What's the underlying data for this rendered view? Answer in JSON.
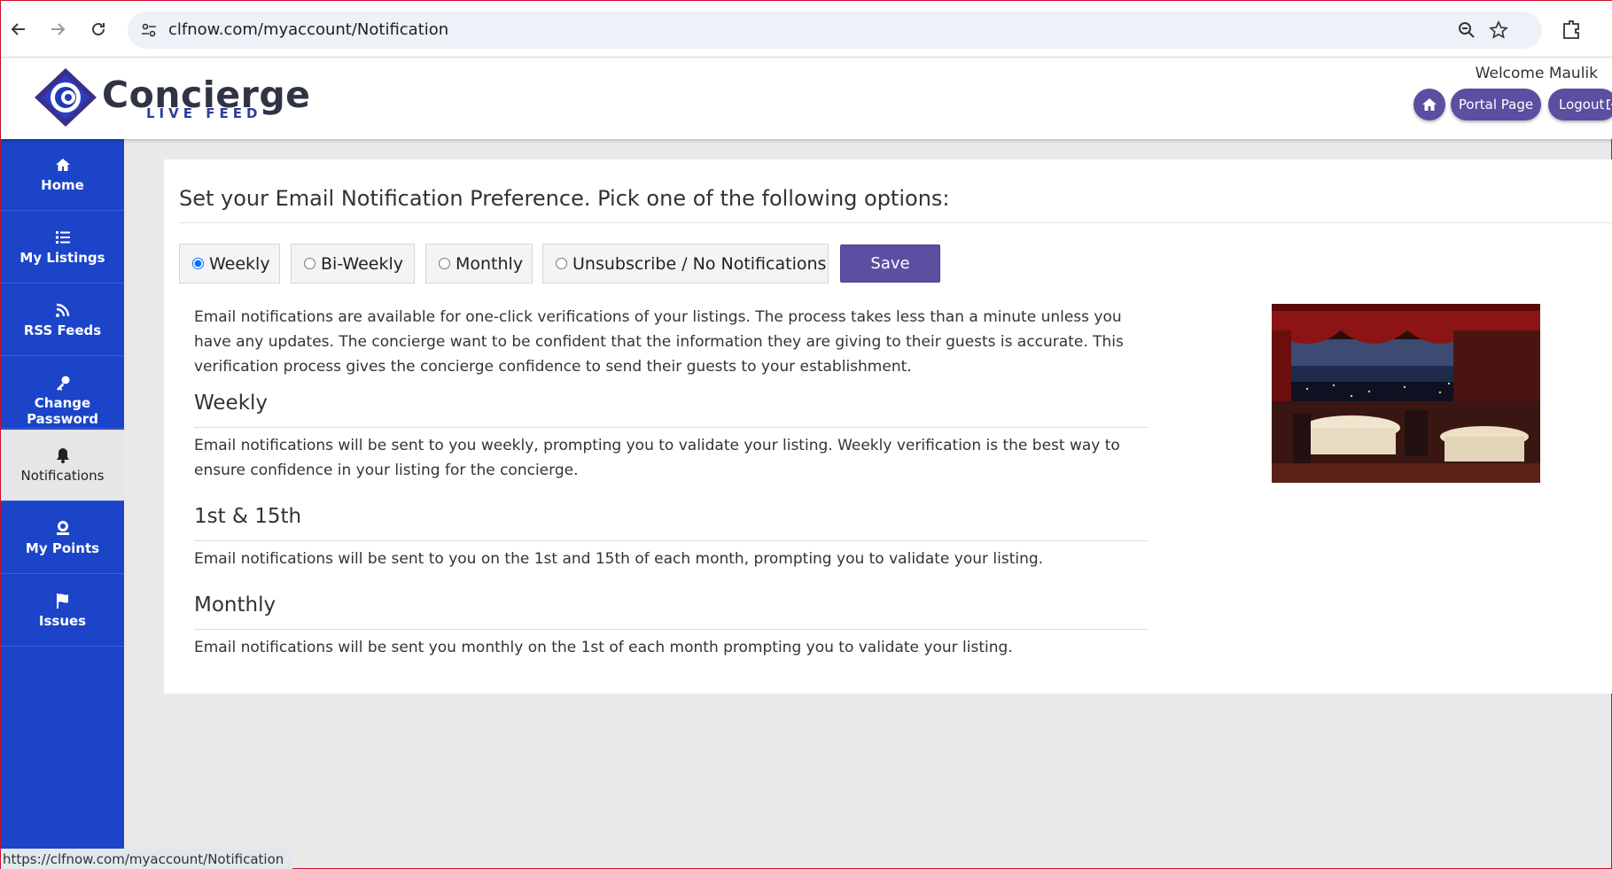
{
  "browser": {
    "url": "clfnow.com/myaccount/Notification",
    "back_icon": "arrow-left-icon",
    "forward_icon": "arrow-right-icon",
    "reload_icon": "reload-icon"
  },
  "header": {
    "logo_name": "Concierge",
    "logo_sub": "LIVE FEED",
    "welcome": "Welcome Maulik",
    "portal_label": "Portal Page",
    "logout_label": "Logout"
  },
  "sidebar": {
    "items": [
      {
        "label": "Home",
        "icon": "home-icon"
      },
      {
        "label": "My Listings",
        "icon": "list-icon"
      },
      {
        "label": "RSS Feeds",
        "icon": "rss-icon"
      },
      {
        "label": "Change Password",
        "icon": "key-icon"
      },
      {
        "label": "Notifications",
        "icon": "bell-icon",
        "active": true
      },
      {
        "label": "My Points",
        "icon": "points-icon"
      },
      {
        "label": "Issues",
        "icon": "flag-icon"
      }
    ]
  },
  "main": {
    "title": "Set your Email Notification Preference. Pick one of the following options:",
    "options": [
      {
        "label": "Weekly",
        "checked": true
      },
      {
        "label": "Bi-Weekly",
        "checked": false
      },
      {
        "label": "Monthly",
        "checked": false
      },
      {
        "label": "Unsubscribe / No Notifications",
        "checked": false
      }
    ],
    "save_label": "Save",
    "intro": "Email notifications are available for one-click verifications of your listings. The process takes less than a minute unless you have any updates. The concierge want to be confident that the information they are giving to their guests is accurate. This verification process gives the concierge confidence to send their guests to your establishment.",
    "sections": [
      {
        "heading": "Weekly",
        "text": "Email notifications will be sent to you weekly, prompting you to validate your listing. Weekly verification is the best way to ensure confidence in your listing for the concierge."
      },
      {
        "heading": "1st & 15th",
        "text": "Email notifications will be sent to you on the 1st and 15th of each month, prompting you to validate your listing."
      },
      {
        "heading": "Monthly",
        "text": "Email notifications will be sent you monthly on the 1st of each month prompting you to validate your listing."
      }
    ]
  },
  "status_url": "https://clfnow.com/myaccount/Notification",
  "colors": {
    "sidebar": "#1b44c8",
    "accent": "#5a4fa0"
  }
}
